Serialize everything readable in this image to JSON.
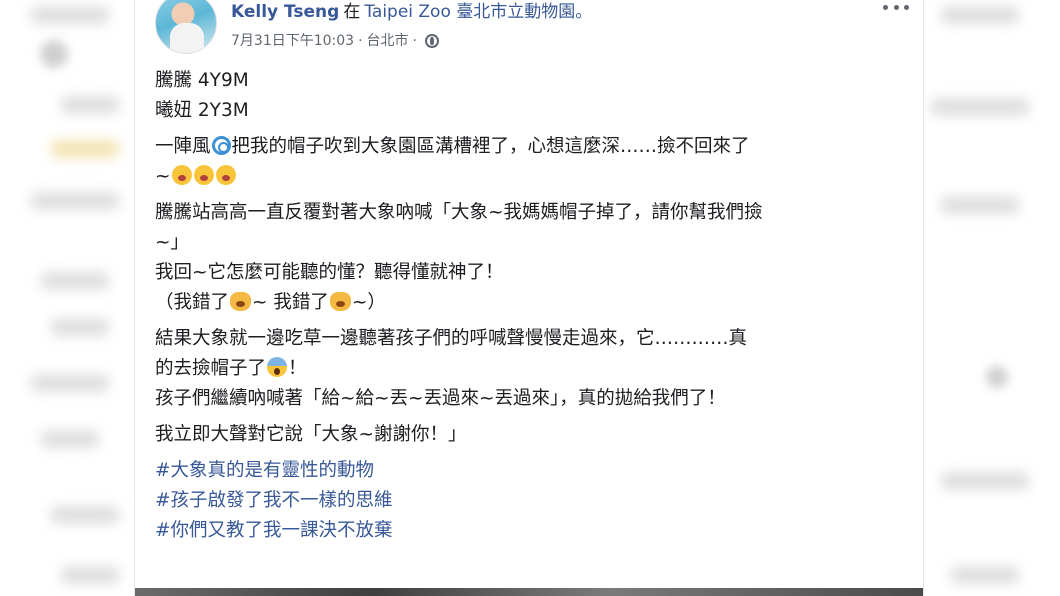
{
  "post": {
    "author": "Kelly Tseng",
    "at_word": "在",
    "place": "Taipei Zoo 臺北市立動物園。",
    "timestamp": "7月31日下午10:03",
    "separator": "·",
    "location": "台北市",
    "separator2": "·",
    "privacy_icon": "globe-icon",
    "more_icon": "more-options-icon"
  },
  "content": {
    "line_1": "騰騰 4Y9M",
    "line_2": "曦妞 2Y3M",
    "line_3a": "一陣風",
    "line_3b": "把我的帽子吹到大象園區溝槽裡了，心想這麼深……撿不回來了",
    "line_4": "~",
    "line_5": "騰騰站高高一直反覆對著大象吶喊「大象~我媽媽帽子掉了，請你幫我們撿",
    "line_6": "~」",
    "line_7": "我回~它怎麼可能聽的懂？聽得懂就神了！",
    "line_8a": "（我錯了",
    "line_8b": "~ 我錯了",
    "line_8c": "~）",
    "line_9": "結果大象就一邊吃草一邊聽著孩子們的呼喊聲慢慢走過來，它…………真",
    "line_10a": "的去撿帽子了",
    "line_10b": "！",
    "line_11": "孩子們繼續吶喊著「給~給~丟~丟過來~丟過來」，真的拋給我們了！",
    "line_12": "我立即大聲對它說「大象~謝謝你！」"
  },
  "hashtags": [
    "#大象真的是有靈性的動物",
    "#孩子啟發了我不一樣的思維",
    "#你們又教了我一課決不放棄"
  ],
  "colors": {
    "link": "#385898",
    "text": "#1c1e21",
    "meta": "#616770"
  }
}
